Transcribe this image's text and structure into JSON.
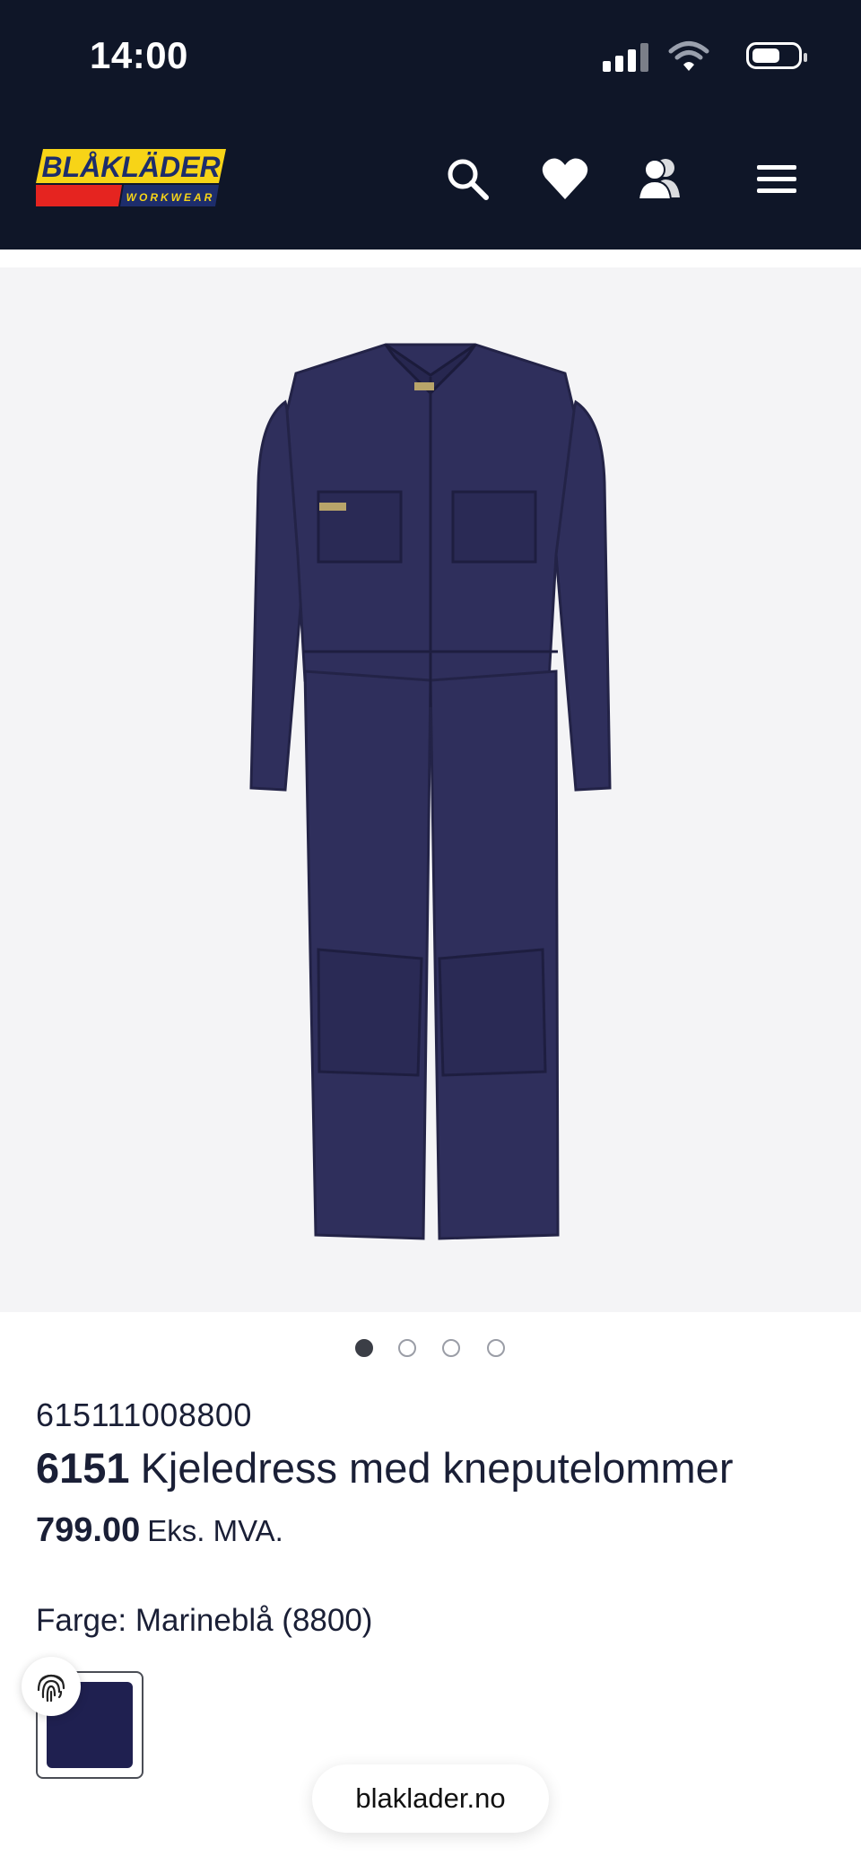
{
  "status_bar": {
    "time": "14:00"
  },
  "header": {
    "logo_text": "BLÅKLÄDER",
    "logo_subtext": "WORKWEAR",
    "icons": [
      "search-icon",
      "heart-icon",
      "account-icon",
      "menu-icon"
    ]
  },
  "gallery": {
    "image_count": 4,
    "active_index": 0,
    "garment_color": "#2f2f5c"
  },
  "product": {
    "sku": "615111008800",
    "model_number": "6151",
    "name": "Kjeledress med kneputelommer",
    "price": "799.00",
    "price_note": "Eks. MVA.",
    "color_label": "Farge: Marineblå (8800)",
    "swatch_color": "#1f2050"
  },
  "browser": {
    "url": "blaklader.no"
  }
}
